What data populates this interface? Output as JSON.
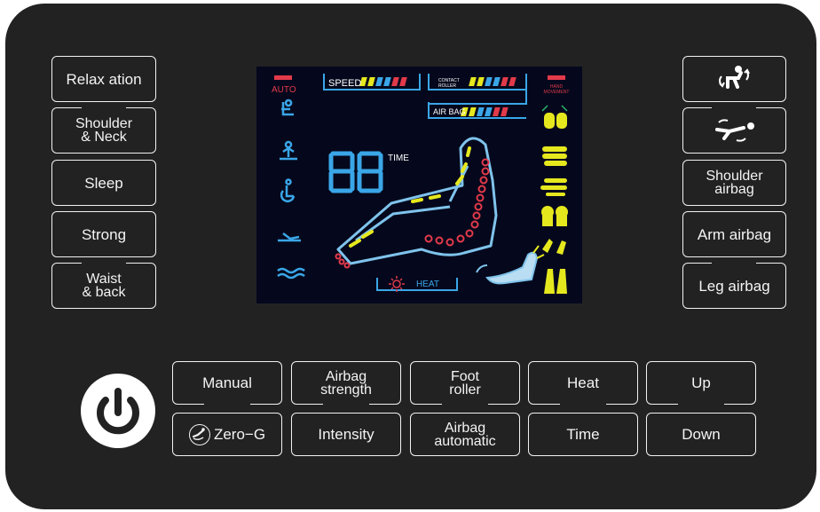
{
  "left_buttons": [
    {
      "label": "Relax ation"
    },
    {
      "label": "Shoulder\n& Neck"
    },
    {
      "label": "Sleep"
    },
    {
      "label": "Strong"
    },
    {
      "label": "Waist\n& back"
    }
  ],
  "right_buttons": [
    {
      "icon": "recline-up-icon"
    },
    {
      "icon": "recline-down-icon"
    },
    {
      "label": "Shoulder\nairbag"
    },
    {
      "label": "Arm airbag"
    },
    {
      "label": "Leg airbag"
    }
  ],
  "bottom_buttons": {
    "row1": [
      "Manual",
      "Airbag\nstrength",
      "Foot\nroller",
      "Heat",
      "Up"
    ],
    "row2": [
      "Zero−G",
      "Intensity",
      "Airbag\nautomatic",
      "Time",
      "Down"
    ]
  },
  "display": {
    "auto_label": "AUTO",
    "speed_label": "SPEED",
    "contact_roller_label": "CONTACT\nROLLER",
    "airbag_label": "AIR BAG",
    "hand_movement_label": "HAND\nMOVEMENT",
    "digits": "88",
    "time_label": "TIME",
    "heat_label": "HEAT"
  },
  "colors": {
    "panel": "#222223",
    "lcd_bg": "#05081c",
    "lcd_blue": "#3aa6e8",
    "lcd_yellow": "#e6e81e",
    "lcd_red": "#e23a4a"
  }
}
